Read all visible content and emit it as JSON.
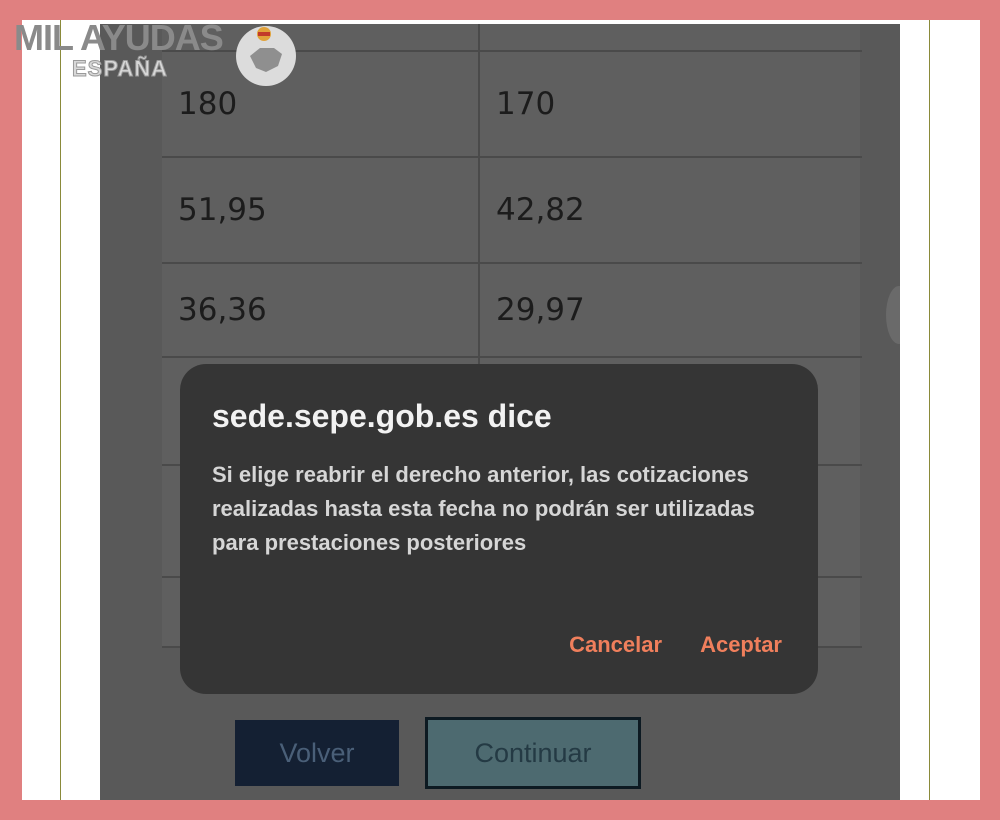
{
  "logo": {
    "main": "MIL AYUDAS",
    "sub": "ESPAÑA"
  },
  "table": {
    "rows": [
      [
        "",
        ""
      ],
      [
        "180",
        "170"
      ],
      [
        "51,95",
        "42,82"
      ],
      [
        "36,36",
        "29,97"
      ],
      [
        "",
        ""
      ],
      [
        "",
        ""
      ],
      [
        "",
        ""
      ]
    ]
  },
  "dialog": {
    "title": "sede.sepe.gob.es dice",
    "message": "Si elige reabrir el derecho anterior, las cotizaciones realizadas hasta esta fecha no podrán ser utilizadas para prestaciones posteriores",
    "cancel": "Cancelar",
    "accept": "Aceptar"
  },
  "buttons": {
    "back": "Volver",
    "continue": "Continuar"
  },
  "colors": {
    "accent": "#f07f5c",
    "border": "#e08080",
    "dialog_bg": "#353535"
  }
}
